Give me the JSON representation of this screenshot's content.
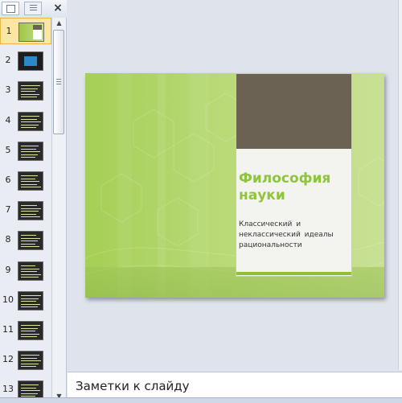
{
  "slide_pane": {
    "close_glyph": "×",
    "slides": [
      {
        "number": "1",
        "selected": true
      },
      {
        "number": "2"
      },
      {
        "number": "3"
      },
      {
        "number": "4"
      },
      {
        "number": "5"
      },
      {
        "number": "6"
      },
      {
        "number": "7"
      },
      {
        "number": "8"
      },
      {
        "number": "9"
      },
      {
        "number": "10"
      },
      {
        "number": "11"
      },
      {
        "number": "12"
      },
      {
        "number": "13"
      }
    ]
  },
  "slide": {
    "title": "Философия науки",
    "subtitle": "Классический и неклассический идеалы рациональности",
    "colors": {
      "background": "#b2d46b",
      "card_header": "#6b6254",
      "title": "#8fc43c",
      "accent_bar": "#8fbf33"
    }
  },
  "notes": {
    "placeholder": "Заметки к слайду"
  }
}
